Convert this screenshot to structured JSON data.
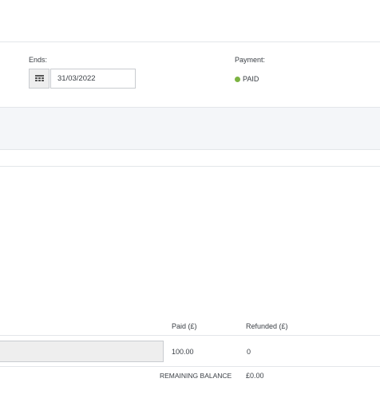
{
  "schedule": {
    "ends_label": "Ends:",
    "ends_value": "31/03/2022",
    "payment_label": "Payment:",
    "payment_status": "PAID",
    "payment_status_color": "#7cb342"
  },
  "payments_table": {
    "columns": [
      "Paid (£)",
      "Refunded (£)"
    ],
    "row": {
      "paid": "100.00",
      "refunded": "0"
    },
    "remaining_balance_label": "REMAINING BALANCE",
    "remaining_balance_value": "£0.00"
  },
  "icons": {
    "date_picker": "calendar-grid-icon"
  }
}
